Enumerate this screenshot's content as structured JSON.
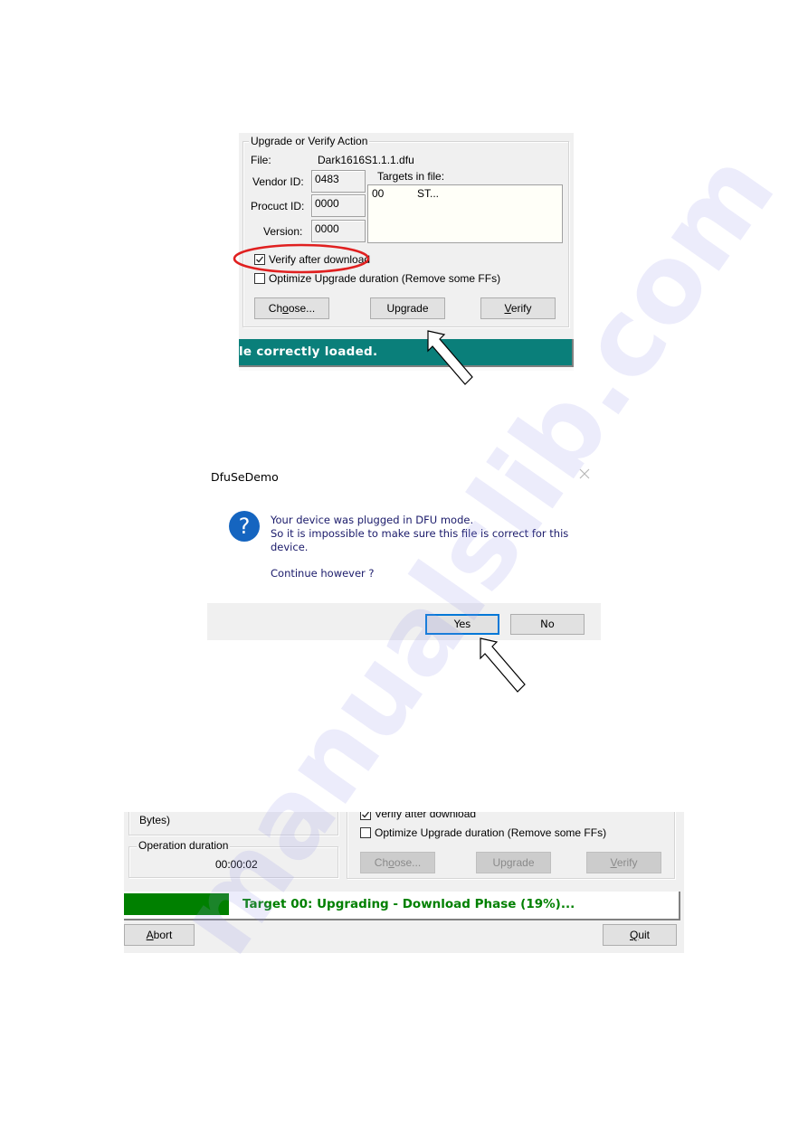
{
  "upgrade_panel": {
    "group_title": "Upgrade or Verify Action",
    "file_label": "File:",
    "file_value": "Dark1616S1.1.1.dfu",
    "vendor_id_label": "Vendor ID:",
    "vendor_id_value": "0483",
    "product_id_label": "Procuct ID:",
    "product_id_value": "0000",
    "version_label": "Version:",
    "version_value": "0000",
    "targets_label": "Targets in file:",
    "targets": [
      {
        "id": "00",
        "name": "ST..."
      }
    ],
    "verify_after_download": {
      "label": "Verify after download",
      "checked": true
    },
    "optimize_upgrade": {
      "label": "Optimize Upgrade duration (Remove some FFs)",
      "checked": false
    },
    "buttons": {
      "choose": {
        "pre": "Ch",
        "ul": "o",
        "post": "ose..."
      },
      "upgrade": {
        "label": "Upgrade"
      },
      "verify": {
        "pre": "",
        "ul": "V",
        "post": "erify"
      }
    },
    "status_text": "le correctly loaded.",
    "status_color": "#0a7f7a"
  },
  "dialog": {
    "title": "DfuSeDemo",
    "icon": "question-icon",
    "message_lines": [
      "Your device was plugged in DFU mode.",
      "So it is impossible to make sure this file is correct for this",
      "device."
    ],
    "question": "Continue however ?",
    "buttons": {
      "yes": "Yes",
      "no": "No"
    },
    "default_button": "yes"
  },
  "progress_panel": {
    "partial_label": "Bytes)",
    "operation_duration_label": "Operation duration",
    "operation_duration_value": "00:00:02",
    "verify_after_download": {
      "label": "Verify after download",
      "checked": true
    },
    "optimize_upgrade": {
      "label": "Optimize Upgrade duration (Remove some FFs)",
      "checked": false
    },
    "buttons": {
      "choose": {
        "pre": "Ch",
        "ul": "o",
        "post": "ose..."
      },
      "upgrade": {
        "label": "Upgrade"
      },
      "verify": {
        "pre": "",
        "ul": "V",
        "post": "erify"
      },
      "abort": {
        "pre": "",
        "ul": "A",
        "post": "bort"
      },
      "quit": {
        "pre": "",
        "ul": "Q",
        "post": "uit"
      }
    },
    "progress_percent": 19,
    "progress_text": "Target 00: Upgrading - Download Phase (19%)...",
    "progress_color": "#008000"
  },
  "watermark": "manualslib.com"
}
